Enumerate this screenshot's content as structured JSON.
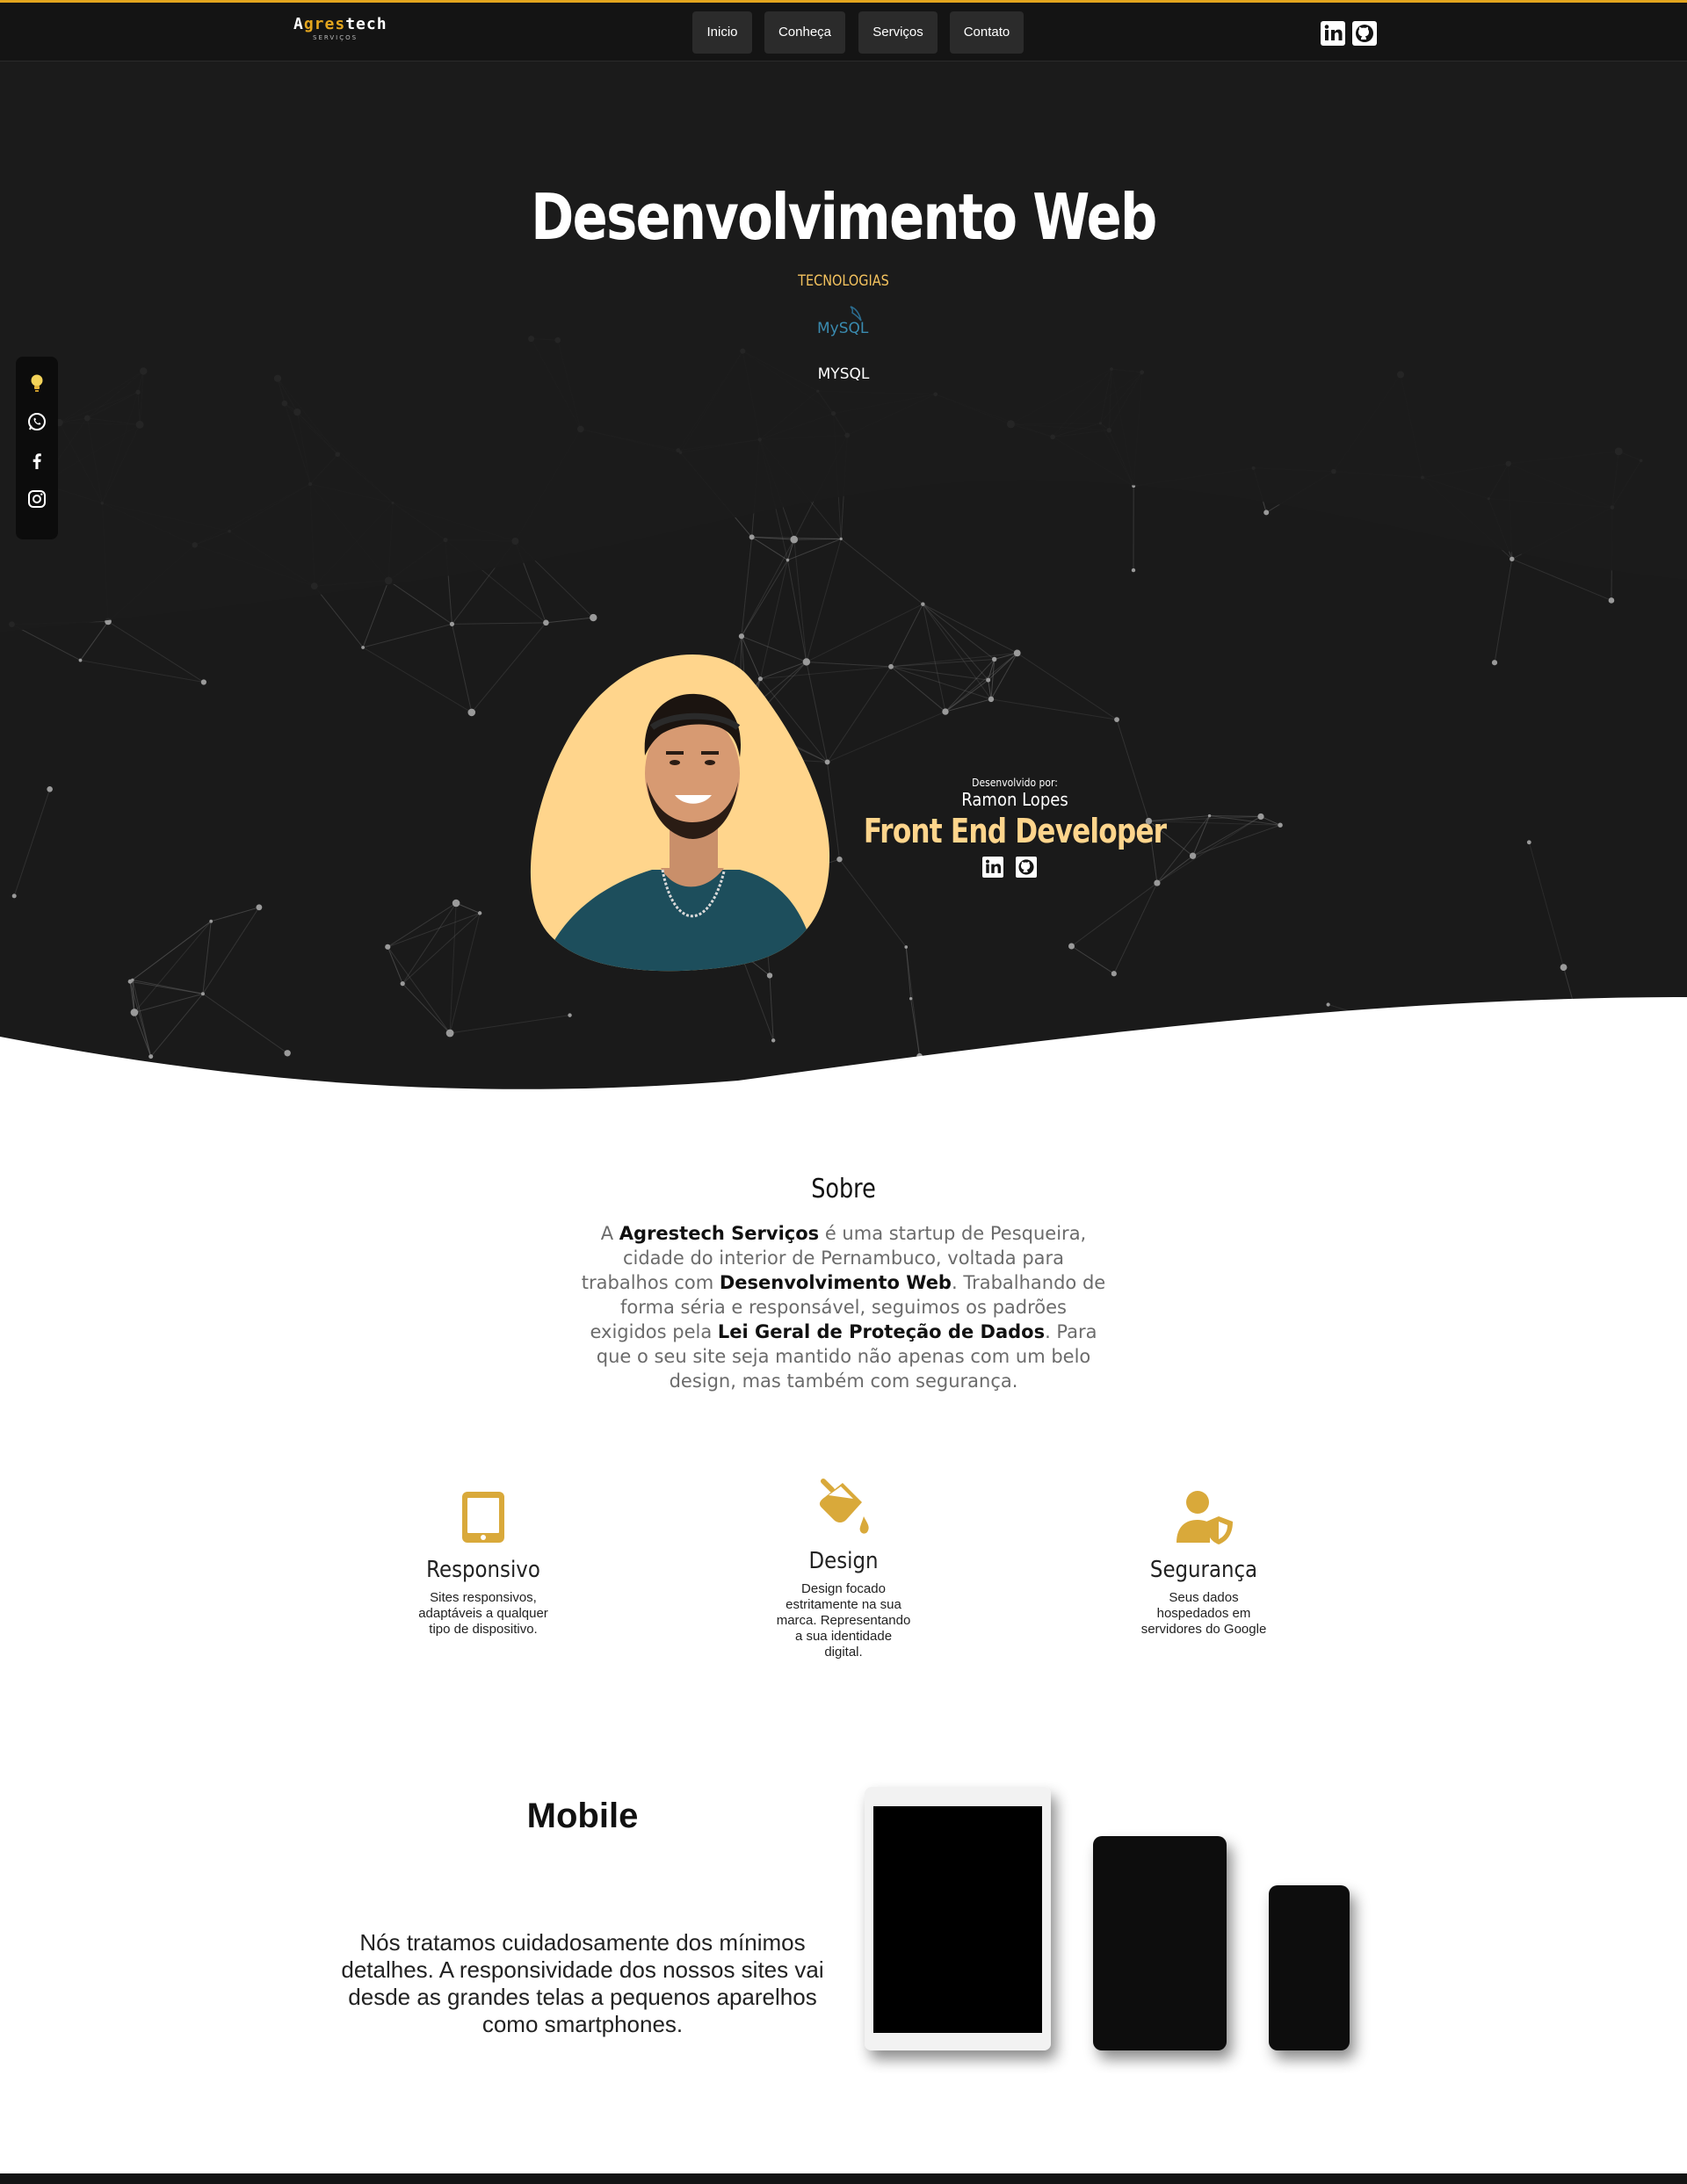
{
  "brand": {
    "name_prefix": "A",
    "name_accent": "gres",
    "name_suffix": "tech",
    "tagline": "SERVIÇOS"
  },
  "nav": {
    "items": [
      "Inicio",
      "Conheça",
      "Serviços",
      "Contato"
    ]
  },
  "hero": {
    "title": "Desenvolvimento Web",
    "tech_label": "TECNOLOGIAS",
    "mysql_logo_text": "MySQL",
    "tech_name": "MYSQL"
  },
  "developer": {
    "credit": "Desenvolvido por:",
    "name": "Ramon Lopes",
    "role": "Front End Developer"
  },
  "side_social": [
    "lightbulb-icon",
    "whatsapp-icon",
    "facebook-icon",
    "instagram-icon"
  ],
  "about": {
    "title": "Sobre",
    "p1": "A ",
    "b1": "Agrestech Serviços",
    "p2": " é uma startup de Pesqueira, cidade do interior de Pernambuco, voltada para trabalhos com ",
    "b2": "Desenvolvimento Web",
    "p3": ". Trabalhando de forma séria e responsável, seguimos os padrões exigidos pela ",
    "b3": "Lei Geral de Proteção de Dados",
    "p4": ". Para que o seu site seja mantido não apenas com um belo design, mas também com segurança."
  },
  "features": [
    {
      "title": "Responsivo",
      "desc": "Sites responsivos, adaptáveis a qualquer tipo de dispositivo.",
      "icon": "tablet-icon"
    },
    {
      "title": "Design",
      "desc": "Design focado estritamente na sua marca. Representando a sua identidade digital.",
      "icon": "paint-bucket-icon"
    },
    {
      "title": "Segurança",
      "desc": "Seus dados hospedados em servidores do Google",
      "icon": "user-shield-icon"
    }
  ],
  "mobile": {
    "title": "Mobile",
    "text": "Nós tratamos cuidadosamente dos mínimos detalhes. A responsividade dos nossos sites vai desde as grandes telas a pequenos aparelhos como smartphones."
  },
  "colors": {
    "accent": "#e3a51e",
    "hero_bg": "#1a1a1a",
    "role": "#ffd58c",
    "icon_gold": "#d9a93a"
  }
}
